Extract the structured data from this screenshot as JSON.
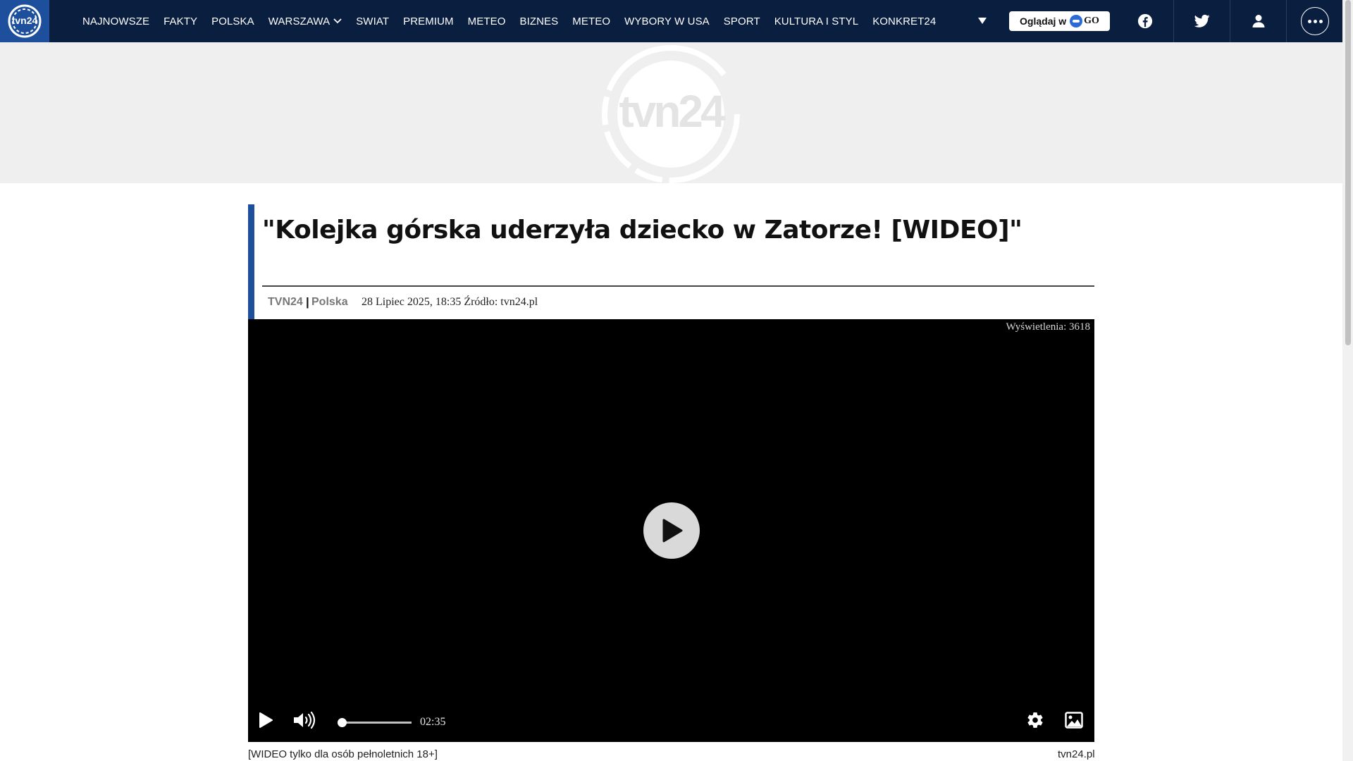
{
  "nav": {
    "logo_text": "tvn24",
    "items": [
      {
        "label": "NAJNOWSZE"
      },
      {
        "label": "FAKTY"
      },
      {
        "label": "POLSKA"
      },
      {
        "label": "WARSZAWA",
        "dropdown": true
      },
      {
        "label": "SWIAT"
      },
      {
        "label": "PREMIUM"
      },
      {
        "label": "METEO"
      },
      {
        "label": "BIZNES"
      },
      {
        "label": "METEO"
      },
      {
        "label": "WYBORY W USA"
      },
      {
        "label": "SPORT"
      },
      {
        "label": "KULTURA I STYL"
      },
      {
        "label": "KONKRET24"
      }
    ],
    "watch_label": "Oglądaj w",
    "watch_go": "GO",
    "icons": [
      "facebook-icon",
      "twitter-icon",
      "user-icon",
      "more-dots-icon"
    ]
  },
  "banner": {
    "logo_text": "tvn24"
  },
  "article": {
    "title": "\"Kolejka górska uderzyła dziecko w Zatorze! [WIDEO]\"",
    "author": "TVN24",
    "separator": "|",
    "category": "Polska",
    "date_source": "28 Lipiec 2025, 18:35 Źródło: tvn24.pl"
  },
  "video": {
    "views": "Wyświetlenia: 3618",
    "duration": "02:35",
    "progress": 0,
    "caption": "[WIDEO tylko dla osób pełnoletnich 18+]",
    "source": "tvn24.pl"
  },
  "colors": {
    "nav_bg": "#0a1e3f",
    "logo_bg": "#1d4f9c",
    "accent_bar": "#1d4f9c",
    "banner_bg": "#efefef"
  }
}
